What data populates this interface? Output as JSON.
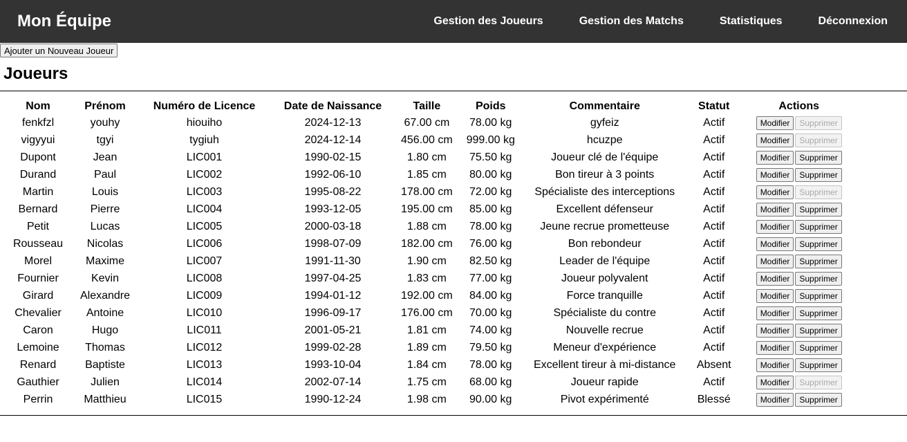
{
  "nav": {
    "brand": "Mon Équipe",
    "links": [
      "Gestion des Joueurs",
      "Gestion des Matchs",
      "Statistiques",
      "Déconnexion"
    ]
  },
  "add_button_label": "Ajouter un Nouveau Joueur",
  "page_title": "Joueurs",
  "table": {
    "headers": [
      "Nom",
      "Prénom",
      "Numéro de Licence",
      "Date de Naissance",
      "Taille",
      "Poids",
      "Commentaire",
      "Statut",
      "Actions"
    ],
    "edit_label": "Modifier",
    "delete_label": "Supprimer",
    "rows": [
      {
        "nom": "fenkfzl",
        "prenom": "youhy",
        "licence": "hiouiho",
        "naissance": "2024-12-13",
        "taille": "67.00 cm",
        "poids": "78.00 kg",
        "commentaire": "gyfeiz",
        "statut": "Actif",
        "delete_enabled": false
      },
      {
        "nom": "vigyyui",
        "prenom": "tgyi",
        "licence": "tygiuh",
        "naissance": "2024-12-14",
        "taille": "456.00 cm",
        "poids": "999.00 kg",
        "commentaire": "hcuzpe",
        "statut": "Actif",
        "delete_enabled": false
      },
      {
        "nom": "Dupont",
        "prenom": "Jean",
        "licence": "LIC001",
        "naissance": "1990-02-15",
        "taille": "1.80 cm",
        "poids": "75.50 kg",
        "commentaire": "Joueur clé de l'équipe",
        "statut": "Actif",
        "delete_enabled": true
      },
      {
        "nom": "Durand",
        "prenom": "Paul",
        "licence": "LIC002",
        "naissance": "1992-06-10",
        "taille": "1.85 cm",
        "poids": "80.00 kg",
        "commentaire": "Bon tireur à 3 points",
        "statut": "Actif",
        "delete_enabled": true
      },
      {
        "nom": "Martin",
        "prenom": "Louis",
        "licence": "LIC003",
        "naissance": "1995-08-22",
        "taille": "178.00 cm",
        "poids": "72.00 kg",
        "commentaire": "Spécialiste des interceptions",
        "statut": "Actif",
        "delete_enabled": false
      },
      {
        "nom": "Bernard",
        "prenom": "Pierre",
        "licence": "LIC004",
        "naissance": "1993-12-05",
        "taille": "195.00 cm",
        "poids": "85.00 kg",
        "commentaire": "Excellent défenseur",
        "statut": "Actif",
        "delete_enabled": true
      },
      {
        "nom": "Petit",
        "prenom": "Lucas",
        "licence": "LIC005",
        "naissance": "2000-03-18",
        "taille": "1.88 cm",
        "poids": "78.00 kg",
        "commentaire": "Jeune recrue prometteuse",
        "statut": "Actif",
        "delete_enabled": true
      },
      {
        "nom": "Rousseau",
        "prenom": "Nicolas",
        "licence": "LIC006",
        "naissance": "1998-07-09",
        "taille": "182.00 cm",
        "poids": "76.00 kg",
        "commentaire": "Bon rebondeur",
        "statut": "Actif",
        "delete_enabled": true
      },
      {
        "nom": "Morel",
        "prenom": "Maxime",
        "licence": "LIC007",
        "naissance": "1991-11-30",
        "taille": "1.90 cm",
        "poids": "82.50 kg",
        "commentaire": "Leader de l'équipe",
        "statut": "Actif",
        "delete_enabled": true
      },
      {
        "nom": "Fournier",
        "prenom": "Kevin",
        "licence": "LIC008",
        "naissance": "1997-04-25",
        "taille": "1.83 cm",
        "poids": "77.00 kg",
        "commentaire": "Joueur polyvalent",
        "statut": "Actif",
        "delete_enabled": true
      },
      {
        "nom": "Girard",
        "prenom": "Alexandre",
        "licence": "LIC009",
        "naissance": "1994-01-12",
        "taille": "192.00 cm",
        "poids": "84.00 kg",
        "commentaire": "Force tranquille",
        "statut": "Actif",
        "delete_enabled": true
      },
      {
        "nom": "Chevalier",
        "prenom": "Antoine",
        "licence": "LIC010",
        "naissance": "1996-09-17",
        "taille": "176.00 cm",
        "poids": "70.00 kg",
        "commentaire": "Spécialiste du contre",
        "statut": "Actif",
        "delete_enabled": true
      },
      {
        "nom": "Caron",
        "prenom": "Hugo",
        "licence": "LIC011",
        "naissance": "2001-05-21",
        "taille": "1.81 cm",
        "poids": "74.00 kg",
        "commentaire": "Nouvelle recrue",
        "statut": "Actif",
        "delete_enabled": true
      },
      {
        "nom": "Lemoine",
        "prenom": "Thomas",
        "licence": "LIC012",
        "naissance": "1999-02-28",
        "taille": "1.89 cm",
        "poids": "79.50 kg",
        "commentaire": "Meneur d'expérience",
        "statut": "Actif",
        "delete_enabled": true
      },
      {
        "nom": "Renard",
        "prenom": "Baptiste",
        "licence": "LIC013",
        "naissance": "1993-10-04",
        "taille": "1.84 cm",
        "poids": "78.00 kg",
        "commentaire": "Excellent tireur à mi-distance",
        "statut": "Absent",
        "delete_enabled": true
      },
      {
        "nom": "Gauthier",
        "prenom": "Julien",
        "licence": "LIC014",
        "naissance": "2002-07-14",
        "taille": "1.75 cm",
        "poids": "68.00 kg",
        "commentaire": "Joueur rapide",
        "statut": "Actif",
        "delete_enabled": false
      },
      {
        "nom": "Perrin",
        "prenom": "Matthieu",
        "licence": "LIC015",
        "naissance": "1990-12-24",
        "taille": "1.98 cm",
        "poids": "90.00 kg",
        "commentaire": "Pivot expérimenté",
        "statut": "Blessé",
        "delete_enabled": true
      }
    ]
  }
}
